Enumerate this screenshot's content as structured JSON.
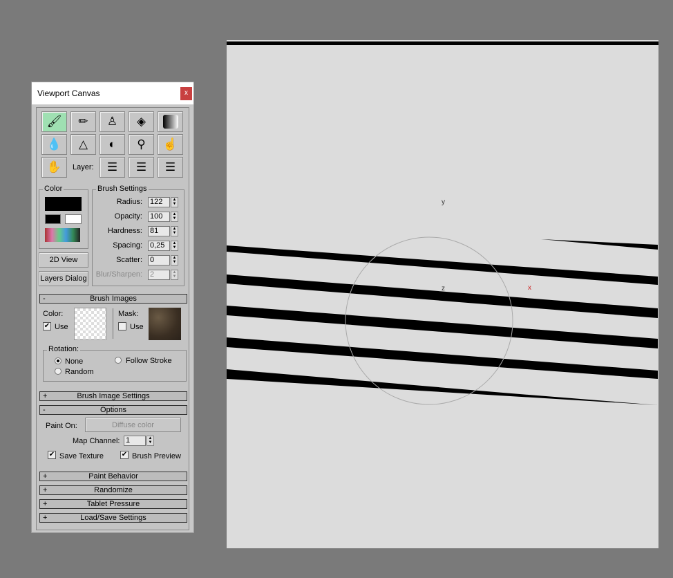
{
  "window": {
    "title": "Viewport Canvas",
    "close": "x"
  },
  "toolbar": {
    "layer_label": "Layer:"
  },
  "color": {
    "group": "Color"
  },
  "brush": {
    "group": "Brush Settings",
    "fields": [
      {
        "label": "Radius:",
        "value": "122"
      },
      {
        "label": "Opacity:",
        "value": "100"
      },
      {
        "label": "Hardness:",
        "value": "81"
      },
      {
        "label": "Spacing:",
        "value": "0,25"
      },
      {
        "label": "Scatter:",
        "value": "0"
      },
      {
        "label": "Blur/Sharpen:",
        "value": "2"
      }
    ]
  },
  "buttons": {
    "view2d": "2D View",
    "layers": "Layers Dialog"
  },
  "brush_images": {
    "title": "Brush Images",
    "toggle": "-",
    "color_label": "Color:",
    "use": "Use",
    "mask_label": "Mask:",
    "mask_use": "Use",
    "rotation": "Rotation:",
    "none": "None",
    "follow": "Follow Stroke",
    "random": "Random"
  },
  "rollouts": {
    "brush_image_settings": "Brush Image Settings",
    "options": "Options",
    "paint_behavior": "Paint Behavior",
    "randomize": "Randomize",
    "tablet": "Tablet Pressure",
    "loadsave": "Load/Save Settings",
    "plus": "+",
    "minus": "-"
  },
  "options": {
    "paint_on": "Paint On:",
    "paint_target": "Diffuse color",
    "map_channel": "Map Channel:",
    "map_value": "1",
    "save_texture": "Save Texture",
    "brush_preview": "Brush Preview"
  },
  "viewport": {
    "axis_y": "y",
    "axis_z": "z",
    "axis_x": "x"
  }
}
